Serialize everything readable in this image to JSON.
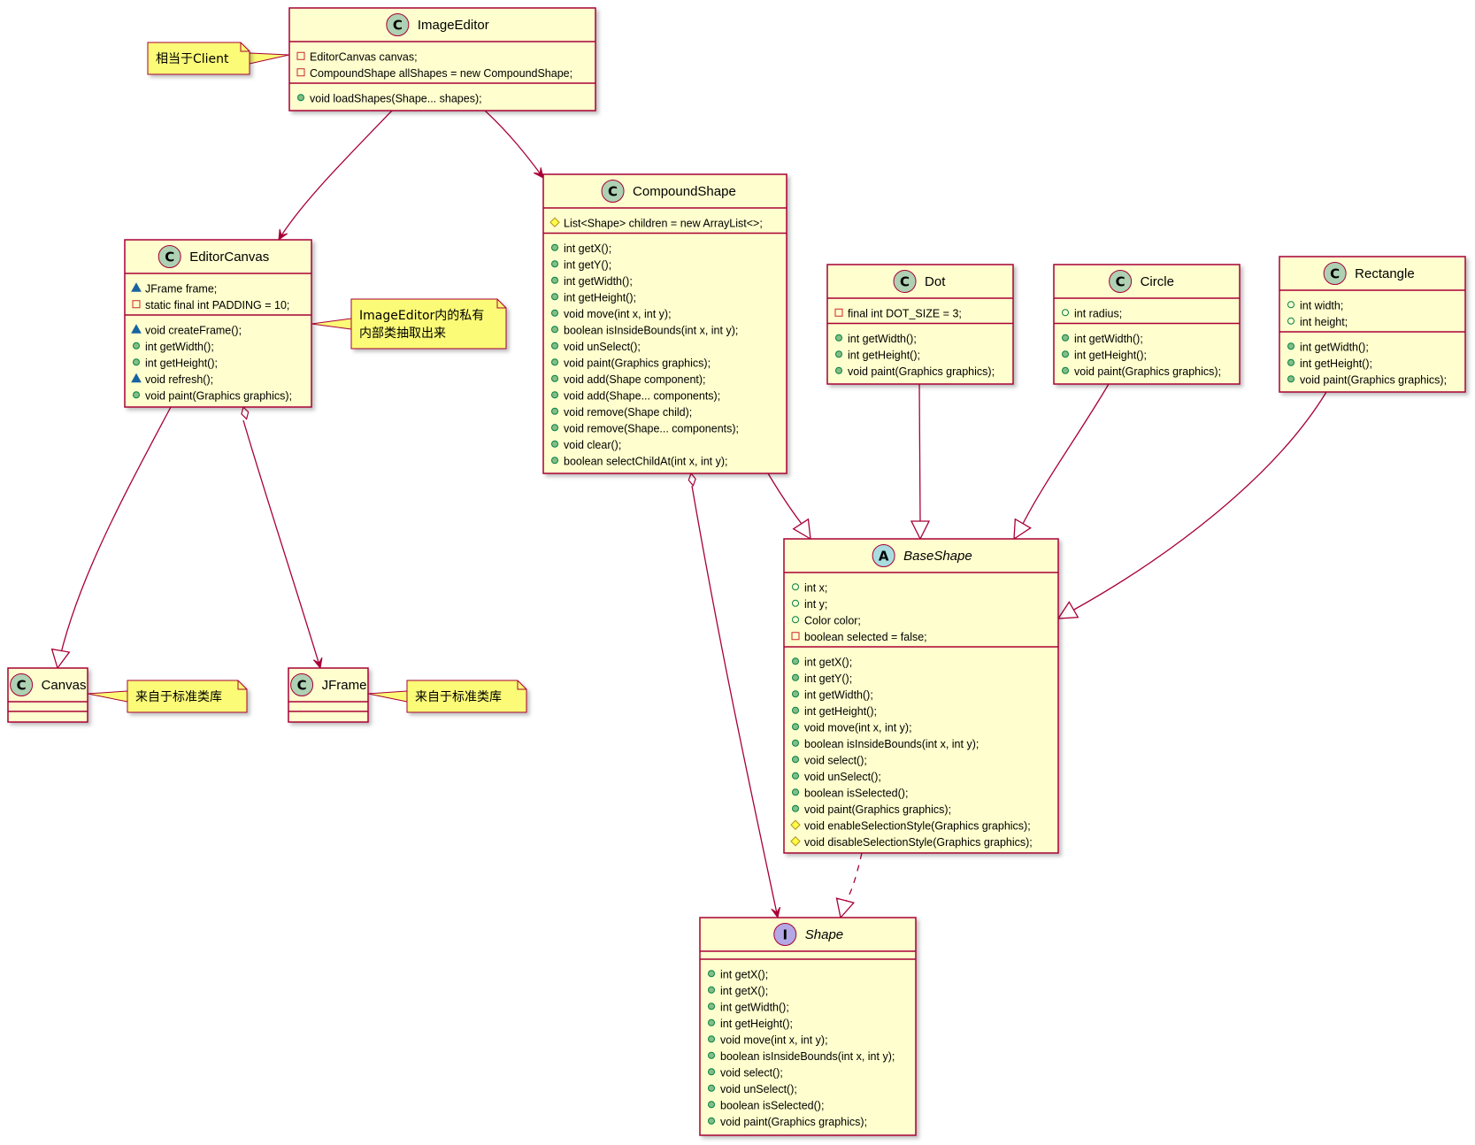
{
  "colors": {
    "class_fill": "#FEFECE",
    "class_border": "#A80036",
    "note_fill": "#FBFB77",
    "note_border": "#A80036",
    "arrow": "#A80036",
    "badge_class": "#ADD1B2",
    "badge_abstract": "#A9DCDF",
    "badge_interface": "#B4A7E5",
    "public": "#84BE84",
    "private": "#C82930",
    "protected": "#FFFF44",
    "package": "#1963A0"
  },
  "classes": {
    "ImageEditor": {
      "name": "ImageEditor",
      "badge": "C",
      "italic": false,
      "fields": [
        {
          "vis": "private",
          "text": "EditorCanvas canvas;"
        },
        {
          "vis": "private",
          "text": "CompoundShape allShapes = new CompoundShape;"
        }
      ],
      "methods": [
        {
          "vis": "public",
          "text": "void loadShapes(Shape... shapes);"
        }
      ]
    },
    "CompoundShape": {
      "name": "CompoundShape",
      "badge": "C",
      "italic": false,
      "fields": [
        {
          "vis": "protected",
          "text": "List<Shape> children = new ArrayList<>;"
        }
      ],
      "methods": [
        {
          "vis": "public",
          "text": "int getX();"
        },
        {
          "vis": "public",
          "text": "int getY();"
        },
        {
          "vis": "public",
          "text": "int getWidth();"
        },
        {
          "vis": "public",
          "text": "int getHeight();"
        },
        {
          "vis": "public",
          "text": "void move(int x, int y);"
        },
        {
          "vis": "public",
          "text": "boolean isInsideBounds(int x, int y);"
        },
        {
          "vis": "public",
          "text": "void unSelect();"
        },
        {
          "vis": "public",
          "text": "void paint(Graphics graphics);"
        },
        {
          "vis": "public",
          "text": "void add(Shape component);"
        },
        {
          "vis": "public",
          "text": "void add(Shape... components);"
        },
        {
          "vis": "public",
          "text": "void remove(Shape child);"
        },
        {
          "vis": "public",
          "text": "void remove(Shape... components);"
        },
        {
          "vis": "public",
          "text": "void clear();"
        },
        {
          "vis": "public",
          "text": "boolean selectChildAt(int x, int y);"
        }
      ]
    },
    "EditorCanvas": {
      "name": "EditorCanvas",
      "badge": "C",
      "italic": false,
      "fields": [
        {
          "vis": "package",
          "text": "JFrame frame;"
        },
        {
          "vis": "private",
          "text": "static final int PADDING = 10;"
        }
      ],
      "methods": [
        {
          "vis": "package",
          "text": "void createFrame();"
        },
        {
          "vis": "public",
          "text": "int getWidth();"
        },
        {
          "vis": "public",
          "text": "int getHeight();"
        },
        {
          "vis": "package",
          "text": "void refresh();"
        },
        {
          "vis": "public",
          "text": "void paint(Graphics graphics);"
        }
      ]
    },
    "Dot": {
      "name": "Dot",
      "badge": "C",
      "italic": false,
      "fields": [
        {
          "vis": "private",
          "text": "final int DOT_SIZE = 3;"
        }
      ],
      "methods": [
        {
          "vis": "public",
          "text": "int getWidth();"
        },
        {
          "vis": "public",
          "text": "int getHeight();"
        },
        {
          "vis": "public",
          "text": "void paint(Graphics graphics);"
        }
      ]
    },
    "Circle": {
      "name": "Circle",
      "badge": "C",
      "italic": false,
      "fields": [
        {
          "vis": "public_field",
          "text": "int radius;"
        }
      ],
      "methods": [
        {
          "vis": "public",
          "text": "int getWidth();"
        },
        {
          "vis": "public",
          "text": "int getHeight();"
        },
        {
          "vis": "public",
          "text": "void paint(Graphics graphics);"
        }
      ]
    },
    "Rectangle": {
      "name": "Rectangle",
      "badge": "C",
      "italic": false,
      "fields": [
        {
          "vis": "public_field",
          "text": "int width;"
        },
        {
          "vis": "public_field",
          "text": "int height;"
        }
      ],
      "methods": [
        {
          "vis": "public",
          "text": "int getWidth();"
        },
        {
          "vis": "public",
          "text": "int getHeight();"
        },
        {
          "vis": "public",
          "text": "void paint(Graphics graphics);"
        }
      ]
    },
    "BaseShape": {
      "name": "BaseShape",
      "badge": "A",
      "italic": true,
      "fields": [
        {
          "vis": "public_field",
          "text": "int x;"
        },
        {
          "vis": "public_field",
          "text": "int y;"
        },
        {
          "vis": "public_field",
          "text": "Color color;"
        },
        {
          "vis": "private",
          "text": "boolean selected = false;"
        }
      ],
      "methods": [
        {
          "vis": "public",
          "text": "int getX();"
        },
        {
          "vis": "public",
          "text": "int getY();"
        },
        {
          "vis": "public",
          "text": "int getWidth();"
        },
        {
          "vis": "public",
          "text": "int getHeight();"
        },
        {
          "vis": "public",
          "text": "void move(int x, int y);"
        },
        {
          "vis": "public",
          "text": "boolean isInsideBounds(int x, int y);"
        },
        {
          "vis": "public",
          "text": "void select();"
        },
        {
          "vis": "public",
          "text": "void unSelect();"
        },
        {
          "vis": "public",
          "text": "boolean isSelected();"
        },
        {
          "vis": "public",
          "text": "void paint(Graphics graphics);"
        },
        {
          "vis": "protected",
          "text": "void enableSelectionStyle(Graphics graphics);"
        },
        {
          "vis": "protected",
          "text": "void disableSelectionStyle(Graphics graphics);"
        }
      ]
    },
    "Canvas": {
      "name": "Canvas",
      "badge": "C",
      "italic": false,
      "fields": [],
      "methods": []
    },
    "JFrame": {
      "name": "JFrame",
      "badge": "C",
      "italic": false,
      "fields": [],
      "methods": []
    },
    "Shape": {
      "name": "Shape",
      "badge": "I",
      "italic": true,
      "fields": [],
      "methods": [
        {
          "vis": "public",
          "text": "int getX();"
        },
        {
          "vis": "public",
          "text": "int getX();"
        },
        {
          "vis": "public",
          "text": "int getWidth();"
        },
        {
          "vis": "public",
          "text": "int getHeight();"
        },
        {
          "vis": "public",
          "text": "void move(int x, int y);"
        },
        {
          "vis": "public",
          "text": "boolean isInsideBounds(int x, int y);"
        },
        {
          "vis": "public",
          "text": "void select();"
        },
        {
          "vis": "public",
          "text": "void unSelect();"
        },
        {
          "vis": "public",
          "text": "boolean isSelected();"
        },
        {
          "vis": "public",
          "text": "void paint(Graphics graphics);"
        }
      ]
    }
  },
  "notes": {
    "client": {
      "lines": [
        "相当于Client"
      ]
    },
    "editorcanvas": {
      "lines": [
        "ImageEditor内的私有",
        "内部类抽取出来"
      ]
    },
    "canvas": {
      "lines": [
        "来自于标准类库"
      ]
    },
    "jframe": {
      "lines": [
        "来自于标准类库"
      ]
    }
  },
  "relations": [
    {
      "from": "ImageEditor",
      "to": "EditorCanvas",
      "type": "association"
    },
    {
      "from": "ImageEditor",
      "to": "CompoundShape",
      "type": "association"
    },
    {
      "from": "EditorCanvas",
      "to": "Canvas",
      "type": "extends"
    },
    {
      "from": "EditorCanvas",
      "to": "JFrame",
      "type": "aggregation"
    },
    {
      "from": "CompoundShape",
      "to": "BaseShape",
      "type": "extends"
    },
    {
      "from": "CompoundShape",
      "to": "Shape",
      "type": "aggregation"
    },
    {
      "from": "Dot",
      "to": "BaseShape",
      "type": "extends"
    },
    {
      "from": "Circle",
      "to": "BaseShape",
      "type": "extends"
    },
    {
      "from": "Rectangle",
      "to": "BaseShape",
      "type": "extends"
    },
    {
      "from": "BaseShape",
      "to": "Shape",
      "type": "implements"
    }
  ]
}
